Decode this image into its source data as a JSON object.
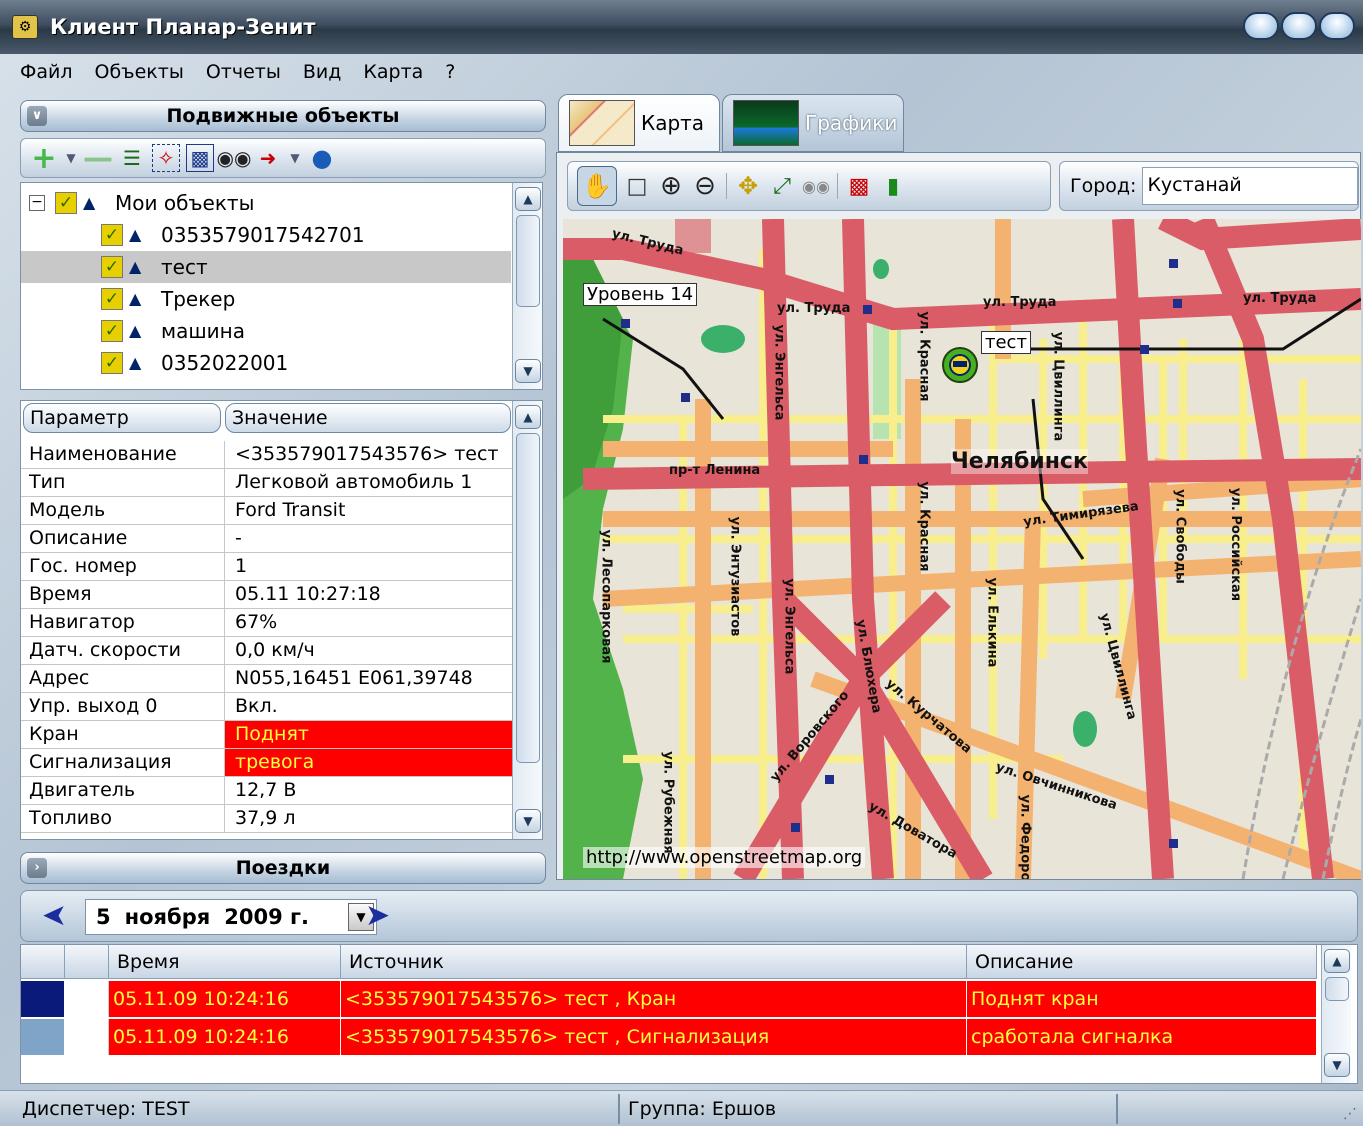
{
  "window": {
    "title": "Клиент Планар-Зенит"
  },
  "menu": [
    "Файл",
    "Объекты",
    "Отчеты",
    "Вид",
    "Карта",
    "?"
  ],
  "objects_panel": {
    "title": "Подвижные объекты",
    "tree_root": "Мои объекты",
    "items": [
      {
        "label": "0353579017542701",
        "selected": false
      },
      {
        "label": "тест",
        "selected": true
      },
      {
        "label": "Трекер",
        "selected": false
      },
      {
        "label": "машина",
        "selected": false
      },
      {
        "label": "0352022001",
        "selected": false
      }
    ]
  },
  "properties": {
    "col_param": "Параметр",
    "col_value": "Значение",
    "rows": [
      {
        "key": "Наименование",
        "value": "<353579017543576> тест",
        "alarm": false
      },
      {
        "key": "Тип",
        "value": "Легковой автомобиль 1",
        "alarm": false
      },
      {
        "key": "Модель",
        "value": "Ford Transit",
        "alarm": false
      },
      {
        "key": "Описание",
        "value": "-",
        "alarm": false
      },
      {
        "key": "Гос. номер",
        "value": "1",
        "alarm": false
      },
      {
        "key": "Время",
        "value": "05.11 10:27:18",
        "alarm": false
      },
      {
        "key": "Навигатор",
        "value": "67%",
        "alarm": false
      },
      {
        "key": "Датч. скорости",
        "value": "0,0 км/ч",
        "alarm": false
      },
      {
        "key": "Адрес",
        "value": "N055,16451 E061,39748",
        "alarm": false
      },
      {
        "key": "Упр. выход 0",
        "value": "Вкл.",
        "alarm": false
      },
      {
        "key": "Кран",
        "value": "Поднят",
        "alarm": true
      },
      {
        "key": "Сигнализация",
        "value": "тревога",
        "alarm": true
      },
      {
        "key": "Двигатель",
        "value": "12,7 В",
        "alarm": false
      },
      {
        "key": "Топливо",
        "value": "37,9 л",
        "alarm": false
      }
    ]
  },
  "tabs": {
    "map": "Карта",
    "charts": "Графики"
  },
  "map": {
    "city_label": "Город:",
    "city_value": "Кустанай",
    "level_label": "Уровень 14",
    "marker_label": "тест",
    "city_name": "Челябинск",
    "attribution": "http://www.openstreetmap.org",
    "streets": [
      "ул. Труда",
      "ул. Труда",
      "ул. Труда",
      "ул. Труда",
      "ул. Энгельса",
      "ул. Красная",
      "ул. Цвиллинга",
      "пр-т Ленина",
      "ул. Тимирязева",
      "ул. Лесопарковая",
      "ул. Энтузиастов",
      "ул. Красная",
      "ул. Энгельса",
      "ул. Свободы",
      "ул. Российская",
      "ул. Елькина",
      "ул. Блюхера",
      "ул. Курчатова",
      "ул. Воровского",
      "ул. Овчинникова",
      "ул. Рубежная",
      "ул. Доватора",
      "ул. Федорова",
      "ул. Цвиллинга"
    ],
    "colors": {
      "main_road": "#d95c66",
      "secondary_road": "#f4b270",
      "minor_road": "#f8ef8c",
      "park": "#52b34a",
      "water": "#86c7a8"
    }
  },
  "trips": {
    "title": "Поездки",
    "date_day": "5",
    "date_month": "ноября",
    "date_year": "2009 г."
  },
  "events": {
    "columns": [
      "Время",
      "Источник",
      "Описание"
    ],
    "rows": [
      {
        "time": "05.11.09 10:24:16",
        "source": "<353579017543576> тест , Кран",
        "description": "Поднят кран",
        "marker_color": "#0a1a7a"
      },
      {
        "time": "05.11.09 10:24:16",
        "source": "<353579017543576> тест , Сигнализация",
        "description": "сработала сигналка",
        "marker_color": "#7fa4c8"
      }
    ]
  },
  "status": {
    "dispatcher": "Диспетчер: TEST",
    "group": "Группа: Ершов"
  }
}
